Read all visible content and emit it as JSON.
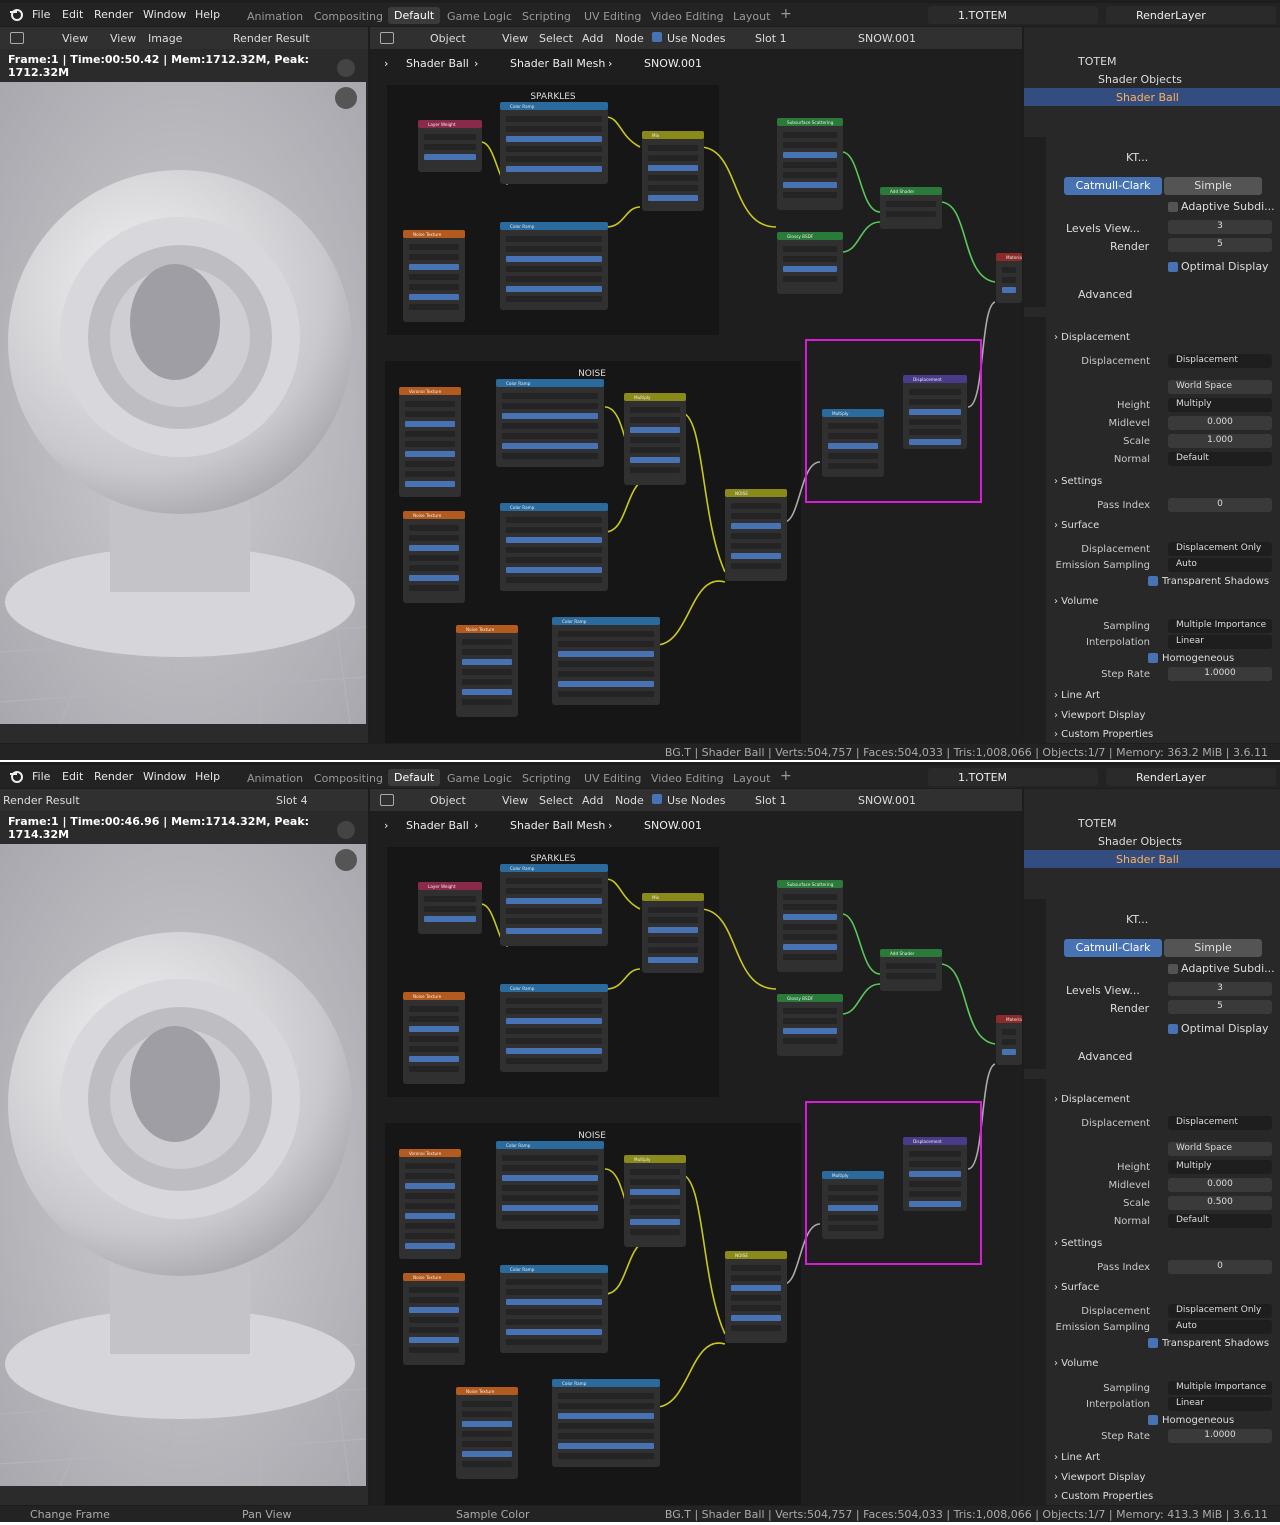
{
  "app": {
    "menus": [
      "File",
      "Edit",
      "Render",
      "Window",
      "Help"
    ],
    "workspaces": [
      "Animation",
      "Compositing",
      "Default",
      "Game Logic",
      "Scripting",
      "UV Editing",
      "Video Editing",
      "Layout"
    ],
    "active_workspace": "Default",
    "scene": "1.TOTEM",
    "view_layer": "RenderLayer"
  },
  "image_editor": {
    "menus": [
      "View",
      "Image"
    ],
    "view_label": "View",
    "image_name": "Render Result"
  },
  "node_editor": {
    "object_mode": "Object",
    "menus": [
      "View",
      "Select",
      "Add",
      "Node"
    ],
    "use_nodes": "Use Nodes",
    "slot": "Slot 1",
    "material": "SNOW.001",
    "breadcrumb": [
      "Shader Ball",
      "Shader Ball Mesh",
      "SNOW.001"
    ],
    "frames": {
      "sparkles": "SPARKLES",
      "noise": "NOISE"
    },
    "nodes": {
      "layer_weight": "Layer Weight",
      "color_ramp": "Color Ramp",
      "mix": "Mix",
      "noise_texture": "Noise Texture",
      "voronoi_texture": "Voronoi Texture",
      "multiply": "Multiply",
      "noise": "NOISE",
      "sss": "Subsurface Scattering",
      "glossy": "Glossy BSDF",
      "add_shader": "Add Shader",
      "material_output": "Material Output",
      "displacement": "Displacement"
    }
  },
  "outliner": {
    "items": [
      "TOTEM",
      "Shader Objects",
      "Shader Ball"
    ]
  },
  "modifier": {
    "name": "KT...",
    "tabs": [
      "Catmull-Clark",
      "Simple"
    ],
    "adaptive": "Adaptive Subdi...",
    "levels_label": "Levels View...",
    "levels_value": "3",
    "render_label": "Render",
    "render_value": "5",
    "optimal": "Optimal Display",
    "advanced": "Advanced"
  },
  "material_props": {
    "displacement_header": "Displacement",
    "displacement_label": "Displacement",
    "displacement_value": "Displacement",
    "space": "World Space",
    "height_label": "Height",
    "height_value": "Multiply",
    "midlevel_label": "Midlevel",
    "midlevel_value": "0.000",
    "scale_label": "Scale",
    "normal_label": "Normal",
    "normal_value": "Default",
    "settings": "Settings",
    "pass_index_label": "Pass Index",
    "pass_index_value": "0",
    "surface": "Surface",
    "disp_method_label": "Displacement",
    "disp_method_value": "Displacement Only",
    "emission_label": "Emission Sampling",
    "emission_value": "Auto",
    "transparent": "Transparent Shadows",
    "volume": "Volume",
    "sampling_label": "Sampling",
    "sampling_value": "Multiple Importance",
    "interp_label": "Interpolation",
    "interp_value": "Linear",
    "homogeneous": "Homogeneous",
    "step_label": "Step Rate",
    "step_value": "1.0000",
    "line_art": "Line Art",
    "viewport_display": "Viewport Display",
    "custom_props": "Custom Properties"
  },
  "panes": [
    {
      "frame_info": "Frame:1 | Time:00:50.42 | Mem:1712.32M, Peak: 1712.32M",
      "scale_value": "1.000",
      "status_left": [
        "",
        "",
        ""
      ],
      "status_right": "BG.T | Shader Ball | Verts:504,757 | Faces:504,033 | Tris:1,008,066 | Objects:1/7 | Memory: 363.2 MiB | 3.6.11",
      "slot_label": "",
      "render_label": "Render Result",
      "disp_scale": "1.000"
    },
    {
      "frame_info": "Frame:1 | Time:00:46.96 | Mem:1714.32M, Peak: 1714.32M",
      "scale_value": "0.500",
      "status_left": [
        "Change Frame",
        "Pan View",
        "Sample Color"
      ],
      "status_right": "BG.T | Shader Ball | Verts:504,757 | Faces:504,033 | Tris:1,008,066 | Objects:1/7 | Memory: 413.3 MiB | 3.6.11",
      "slot_label": "Slot 4",
      "render_label": "Render Result",
      "disp_scale": "0.500"
    }
  ],
  "colors": {
    "accent": "#4772b3",
    "frame_highlight": "#d31ed3",
    "header_blue": "#2a6a9c",
    "header_yellow": "#8a8a1a",
    "header_green": "#2a7a3a",
    "header_orange": "#b35a1e",
    "header_purple": "#4a3a8a",
    "link_yellow": "#c8c81e",
    "link_green": "#5ac85a"
  }
}
